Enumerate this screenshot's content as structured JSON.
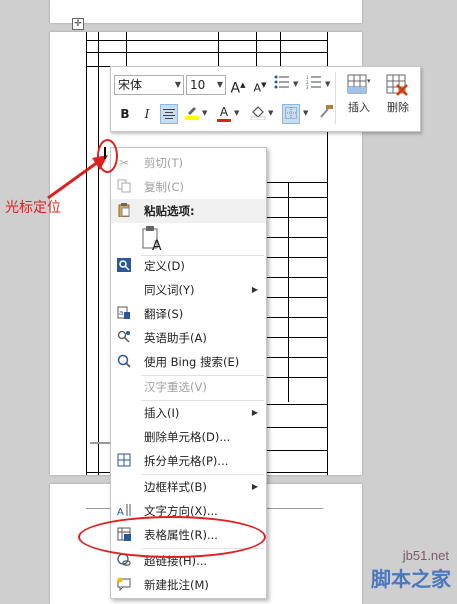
{
  "toolbar": {
    "font_name": "宋体",
    "font_size": "10",
    "insert_label": "插入",
    "delete_label": "删除",
    "colors": {
      "highlight": "#ffff00",
      "font_color": "#e02020",
      "accent": "#2b579a"
    }
  },
  "context_menu": {
    "items": [
      {
        "label": "剪切(T)",
        "icon": "scissors-icon",
        "disabled": true
      },
      {
        "label": "复制(C)",
        "icon": "copy-icon",
        "disabled": true
      },
      {
        "label": "粘贴选项:",
        "icon": "paste-icon",
        "disabled": false
      },
      {
        "label": "定义(D)",
        "icon": "define-icon",
        "disabled": false
      },
      {
        "label": "同义词(Y)",
        "icon": "",
        "disabled": false
      },
      {
        "label": "翻译(S)",
        "icon": "translate-icon",
        "disabled": false
      },
      {
        "label": "英语助手(A)",
        "icon": "english-assistant-icon",
        "disabled": false
      },
      {
        "label": "使用 Bing 搜索(E)",
        "icon": "bing-search-icon",
        "disabled": false
      },
      {
        "label": "汉字重选(V)",
        "icon": "",
        "disabled": true
      },
      {
        "label": "插入(I)",
        "icon": "",
        "disabled": false
      },
      {
        "label": "删除单元格(D)...",
        "icon": "",
        "disabled": false
      },
      {
        "label": "拆分单元格(P)...",
        "icon": "split-cells-icon",
        "disabled": false
      },
      {
        "label": "边框样式(B)",
        "icon": "",
        "disabled": false
      },
      {
        "label": "文字方向(X)...",
        "icon": "text-direction-icon",
        "disabled": false
      },
      {
        "label": "表格属性(R)...",
        "icon": "table-properties-icon",
        "disabled": false
      },
      {
        "label": "超链接(H)...",
        "icon": "hyperlink-icon",
        "disabled": false
      },
      {
        "label": "新建批注(M)",
        "icon": "new-comment-icon",
        "disabled": false
      }
    ]
  },
  "annotation": {
    "label": "光标定位",
    "color": "#e02020"
  },
  "watermark": {
    "line1": "jb51.net",
    "line2": "脚本之家"
  }
}
